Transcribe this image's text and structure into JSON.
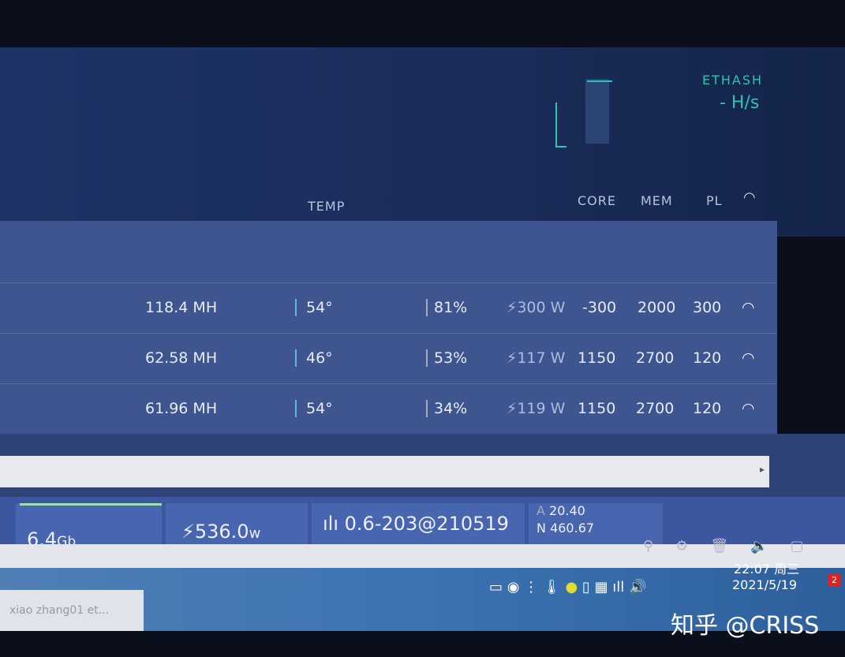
{
  "algo": {
    "name": "ETHASH",
    "hashrate": "- H/s"
  },
  "headers": {
    "temp": "TEMP",
    "core": "CORE",
    "mem": "MEM",
    "pl": "PL"
  },
  "gpus": [
    {
      "hash": "118.4 MH",
      "temp": "54°",
      "fan": "81%",
      "power": "300 W",
      "core": "-300",
      "mem": "2000",
      "pl": "300"
    },
    {
      "hash": "62.58 MH",
      "temp": "46°",
      "fan": "53%",
      "power": "117 W",
      "core": "1150",
      "mem": "2700",
      "pl": "120"
    },
    {
      "hash": "61.96 MH",
      "temp": "54°",
      "fan": "34%",
      "power": "119 W",
      "core": "1150",
      "mem": "2700",
      "pl": "120"
    }
  ],
  "status": {
    "memory": "6.4",
    "memory_unit": "Gb",
    "power": "536.0",
    "power_unit": "w",
    "version": "0.6-203@210519",
    "a_label": "A",
    "a_value": "20.40",
    "n_label": "N",
    "n_value": "460.67"
  },
  "taskbar": {
    "window": "xiao zhang01 et...",
    "time": "22:07 周三",
    "date": "2021/5/19",
    "notifications": "2"
  },
  "watermark": "知乎 @CRISS",
  "colors": {
    "accent": "#2fc4b0"
  }
}
